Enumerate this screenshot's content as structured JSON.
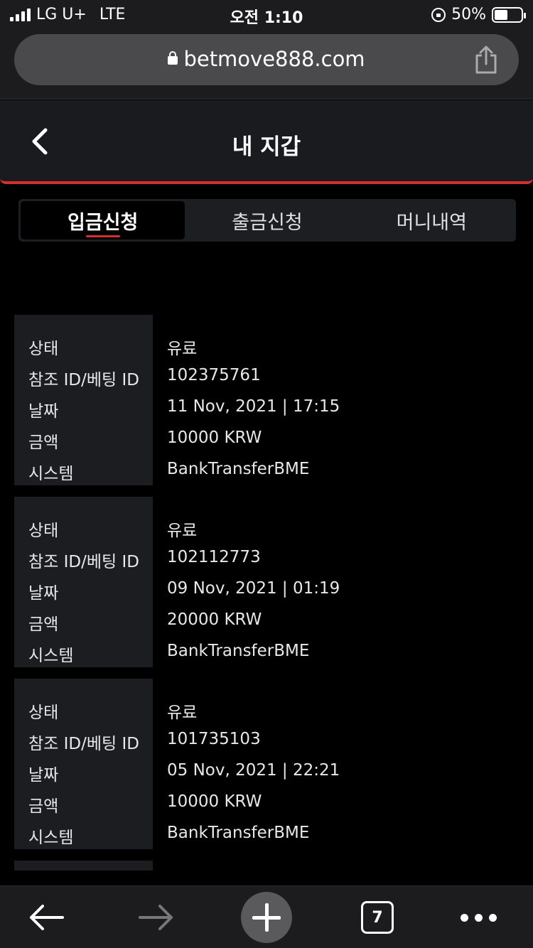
{
  "status_bar": {
    "carrier": "LG U+",
    "network": "LTE",
    "time": "오전 1:10",
    "battery_percent": "50%",
    "battery_level": 0.5
  },
  "browser": {
    "url": "betmove888.com",
    "tab_count": "7"
  },
  "header": {
    "title": "내 지갑"
  },
  "tabs": [
    {
      "label": "입금신청",
      "active": true
    },
    {
      "label": "출금신청",
      "active": false
    },
    {
      "label": "머니내역",
      "active": false
    }
  ],
  "field_labels": {
    "status": "상태",
    "ref_id": "참조 ID/베팅 ID",
    "date": "날짜",
    "amount": "금액",
    "system": "시스템"
  },
  "records": [
    {
      "status": "유료",
      "ref_id": "102375761",
      "date": "11 Nov, 2021 | 17:15",
      "amount": "10000 KRW",
      "system": "BankTransferBME"
    },
    {
      "status": "유료",
      "ref_id": "102112773",
      "date": "09 Nov, 2021 | 01:19",
      "amount": "20000 KRW",
      "system": "BankTransferBME"
    },
    {
      "status": "유료",
      "ref_id": "101735103",
      "date": "05 Nov, 2021 | 22:21",
      "amount": "10000 KRW",
      "system": "BankTransferBME"
    }
  ],
  "colors": {
    "accent": "#d32f2f",
    "panel": "#1c1d21",
    "background": "#000000"
  }
}
